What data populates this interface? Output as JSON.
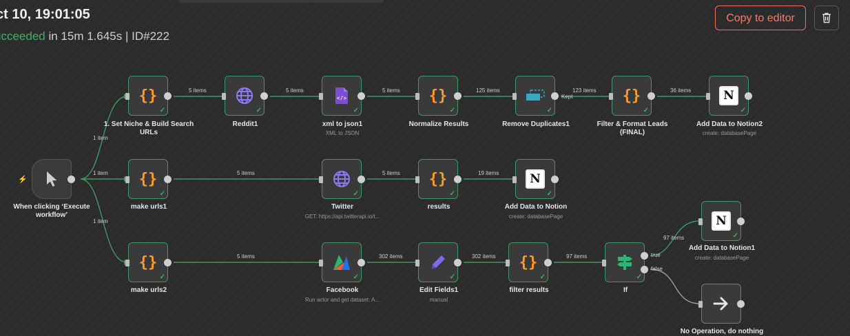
{
  "header": {
    "title": "ct 10, 19:01:05",
    "status_word": "ucceeded",
    "status_rest": " in 15m 1.645s | ID#222",
    "copy_label": "Copy to editor"
  },
  "nodes": {
    "trigger": {
      "label": "When clicking ‘Execute workflow’"
    },
    "set_niche": {
      "label": "1. Set Niche & Build Search URLs"
    },
    "reddit": {
      "label": "Reddit1"
    },
    "xml": {
      "label": "xml to json1",
      "sub": "XML to JSON"
    },
    "normalize": {
      "label": "Normalize Results"
    },
    "dedupe": {
      "label": "Remove Duplicates1"
    },
    "filter_format": {
      "label": "Filter & Format Leads (FINAL)"
    },
    "notion2": {
      "label": "Add Data to Notion2",
      "sub": "create: databasePage"
    },
    "make_urls1": {
      "label": "make urls1"
    },
    "twitter": {
      "label": "Twitter",
      "sub": "GET: https://api.twitterapi.io/t..."
    },
    "results": {
      "label": "results"
    },
    "notion": {
      "label": "Add Data to Notion",
      "sub": "create: databasePage"
    },
    "make_urls2": {
      "label": "make urls2"
    },
    "facebook": {
      "label": "Facebook",
      "sub": "Run actor and get dataset: A..."
    },
    "edit_fields": {
      "label": "Edit Fields1",
      "sub": "manual"
    },
    "filter_results": {
      "label": "filter results"
    },
    "if": {
      "label": "If"
    },
    "notion1": {
      "label": "Add Data to Notion1",
      "sub": "create: databasePage"
    },
    "noop": {
      "label": "No Operation, do nothing"
    }
  },
  "edges": {
    "t_row1": "1 item",
    "t_row2": "1 item",
    "t_row3": "1 item",
    "r1_a": "5 items",
    "r1_b": "5 items",
    "r1_c": "5 items",
    "r1_d": "125 items",
    "r1_e": "123 items",
    "r1_kept": "Kept",
    "r1_f": "36 items",
    "r2_a": "5 items",
    "r2_b": "5 items",
    "r2_c": "19 items",
    "r3_a": "5 items",
    "r3_b": "302 items",
    "r3_c": "302 items",
    "r3_d": "97 items",
    "if_true_count": "97 items",
    "if_true": "true",
    "if_false": "false"
  },
  "colors": {
    "success": "#3fb068",
    "accent": "#ff6d5a",
    "edge": "#3d9b5f",
    "edge_idle": "#9a9a9a"
  }
}
